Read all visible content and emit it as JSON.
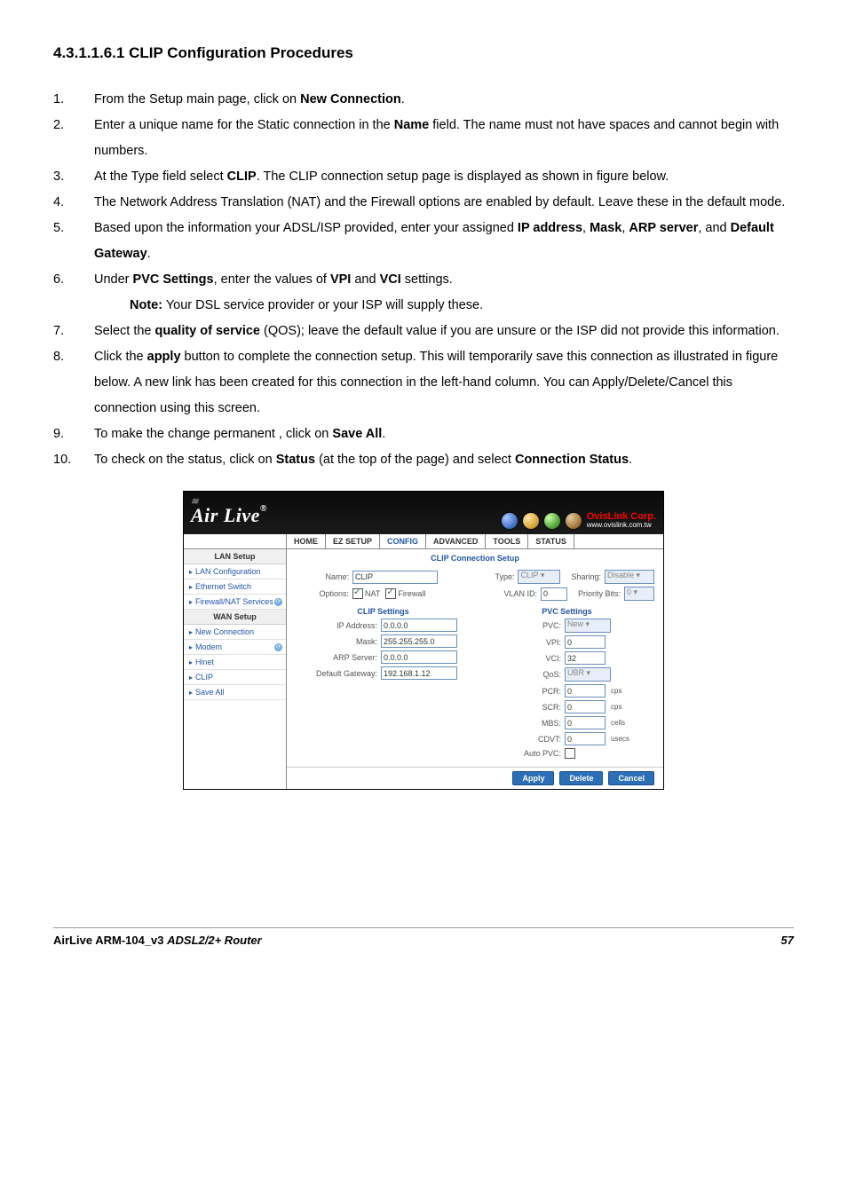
{
  "heading": "4.3.1.1.6.1 CLIP Configuration Procedures",
  "steps": [
    {
      "n": "1.",
      "html": "From the Setup main page, click on <b>New Connection</b>."
    },
    {
      "n": "2.",
      "html": "Enter a unique name for the Static connection in the <b>Name</b> field. The name must not have spaces and cannot begin with numbers."
    },
    {
      "n": "3.",
      "html": "At the Type field select <b>CLIP</b>. The CLIP connection setup page is displayed as shown in figure below."
    },
    {
      "n": "4.",
      "html": "The Network Address Translation (NAT) and the Firewall options are enabled by default. Leave these in the default mode."
    },
    {
      "n": "5.",
      "html": "Based upon the information your ADSL/ISP provided, enter your assigned <b>IP address</b>, <b>Mask</b>, <b>ARP server</b>, and <b>Default Gateway</b>."
    },
    {
      "n": "6.",
      "html": "Under <b>PVC Settings</b>, enter the values of <b>VPI</b> and <b>VCI</b> settings.",
      "note": "<b>Note:</b> Your DSL service provider or your ISP will supply these."
    },
    {
      "n": "7.",
      "html": "Select the <b>quality of service</b> (QOS); leave the default value if you are unsure or the ISP did not provide this information."
    },
    {
      "n": "8.",
      "html": "Click the <b>apply</b> button to complete the connection setup. This will temporarily save this connection as illustrated in figure below. A new link has been created for this connection in the left-hand column. You can Apply/Delete/Cancel this connection using this screen."
    },
    {
      "n": "9.",
      "html": "To make the change permanent , click on <b>Save All</b>."
    },
    {
      "n": "10.",
      "html": "To check on the status, click on <b>Status</b> (at the top of the page) and select <b>Connection Status</b>."
    }
  ],
  "shot": {
    "logo": "Air Live",
    "ovis_top": "OvisLink Corp.",
    "ovis_bottom": "www.ovislink.com.tw",
    "tabs": [
      "HOME",
      "EZ SETUP",
      "CONFIG",
      "ADVANCED",
      "TOOLS",
      "STATUS"
    ],
    "active_tab": "CONFIG",
    "sidebar": {
      "lan_head": "LAN Setup",
      "lan_items": [
        {
          "label": "LAN Configuration",
          "icon": false
        },
        {
          "label": "Ethernet Switch",
          "icon": false
        },
        {
          "label": "Firewall/NAT Services",
          "icon": true
        }
      ],
      "wan_head": "WAN Setup",
      "wan_items": [
        {
          "label": "New Connection",
          "icon": false
        },
        {
          "label": "Modem",
          "icon": true
        },
        {
          "label": "Hinet",
          "icon": false
        },
        {
          "label": "CLIP",
          "icon": false
        },
        {
          "label": "Save All",
          "icon": false
        }
      ]
    },
    "main_title": "CLIP Connection Setup",
    "top": {
      "name_label": "Name:",
      "name_value": "CLIP",
      "type_label": "Type:",
      "type_value": "CLIP",
      "sharing_label": "Sharing:",
      "sharing_value": "Disable",
      "options_label": "Options:",
      "nat": "NAT",
      "firewall": "Firewall",
      "vlan_label": "VLAN ID:",
      "vlan_value": "0",
      "prio_label": "Priority Bits:",
      "prio_value": "0"
    },
    "clip_col": {
      "title": "CLIP Settings",
      "ip_label": "IP Address:",
      "ip_val": "0.0.0.0",
      "mask_label": "Mask:",
      "mask_val": "255.255.255.0",
      "arp_label": "ARP Server:",
      "arp_val": "0.0.0.0",
      "gw_label": "Default Gateway:",
      "gw_val": "192.168.1.12"
    },
    "pvc_col": {
      "title": "PVC Settings",
      "pvc_label": "PVC:",
      "pvc_val": "New",
      "vpi_label": "VPI:",
      "vpi_val": "0",
      "vci_label": "VCI:",
      "vci_val": "32",
      "qos_label": "QoS:",
      "qos_val": "UBR",
      "pcr_label": "PCR:",
      "pcr_val": "0",
      "pcr_unit": "cps",
      "scr_label": "SCR:",
      "scr_val": "0",
      "scr_unit": "cps",
      "mbs_label": "MBS:",
      "mbs_val": "0",
      "mbs_unit": "cells",
      "cdvt_label": "CDVT:",
      "cdvt_val": "0",
      "cdvt_unit": "usecs",
      "auto_label": "Auto PVC:"
    },
    "buttons": {
      "apply": "Apply",
      "delete": "Delete",
      "cancel": "Cancel"
    }
  },
  "footer": {
    "left_bold": "AirLive ARM-104_v3 ",
    "left_italic": "ADSL2/2+ Router",
    "page": "57"
  }
}
